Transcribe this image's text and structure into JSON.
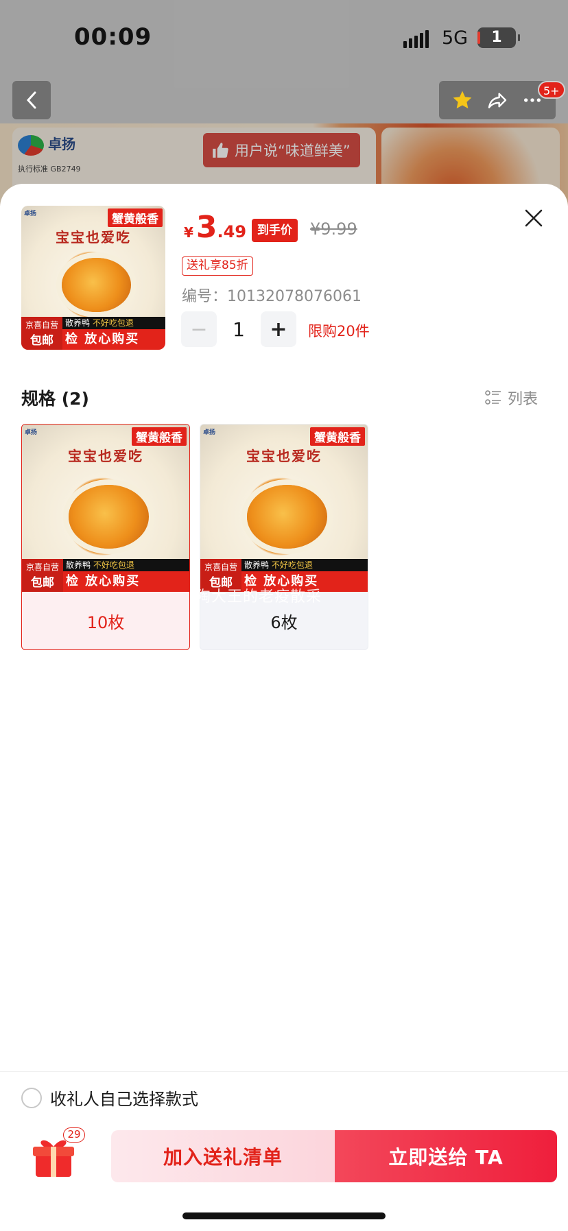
{
  "status_bar": {
    "time": "00:09",
    "network": "5G",
    "battery": "1"
  },
  "background": {
    "brand": "卓扬",
    "standard": "执行标准 GB2749",
    "praise": "用户说“味道鲜美”",
    "more_badge": "5+"
  },
  "product": {
    "thumb": {
      "tag_top": "蟹黄般香",
      "slogan": "宝宝也爱吃",
      "strip_text": "散养鸭",
      "strip_highlight": "不好吃包退",
      "red_bar": "检 放心购买",
      "ship_top": "京喜自营",
      "ship_main": "包邮",
      "logo": "卓扬"
    },
    "price_symbol": "¥",
    "price_int": "3",
    "price_dec": ".49",
    "price_tag": "到手价",
    "old_price": "¥9.99",
    "discount_tag": "送礼享85折",
    "sku_label": "编号：10132078076061",
    "quantity": "1",
    "minus": "−",
    "plus": "+",
    "limit": "限购20件"
  },
  "specs": {
    "title": "规格 (2)",
    "list_label": "列表",
    "items": [
      {
        "label": "10枚",
        "selected": true
      },
      {
        "label": "6枚",
        "selected": false
      }
    ],
    "ghost_text": "陶大王的老疫散采"
  },
  "footer": {
    "radio_label": "收礼人自己选择款式",
    "gift_count": "29",
    "add_button": "加入送礼清单",
    "send_button": "立即送给 TA"
  },
  "colors": {
    "accent": "#e2231a",
    "send_btn": "#ef1f3c",
    "add_btn_bg": "#fde8ec"
  }
}
